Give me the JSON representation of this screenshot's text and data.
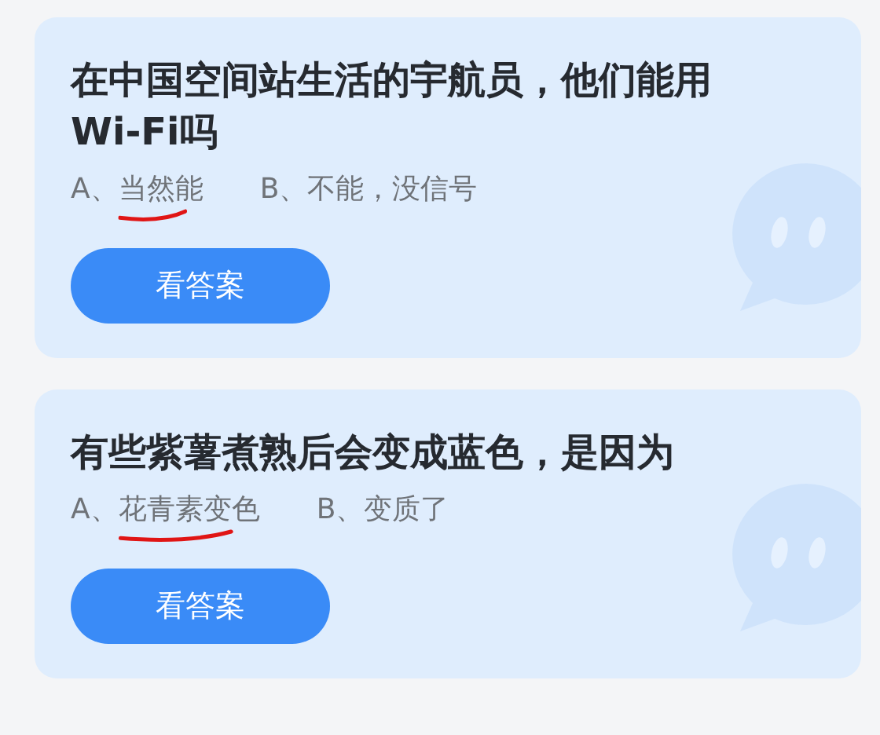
{
  "questions": [
    {
      "title": "在中国空间站生活的宇航员，他们能用Wi-Fi吗",
      "options": [
        {
          "letter": "A、",
          "answer": "当然能",
          "marked": true
        },
        {
          "letter": "B、",
          "answer": "不能，没信号",
          "marked": false
        }
      ],
      "button": "看答案"
    },
    {
      "title": "有些紫薯煮熟后会变成蓝色，是因为",
      "options": [
        {
          "letter": "A、",
          "answer": "花青素变色",
          "marked": true
        },
        {
          "letter": "B、",
          "answer": "变质了",
          "marked": false
        }
      ],
      "button": "看答案"
    }
  ]
}
